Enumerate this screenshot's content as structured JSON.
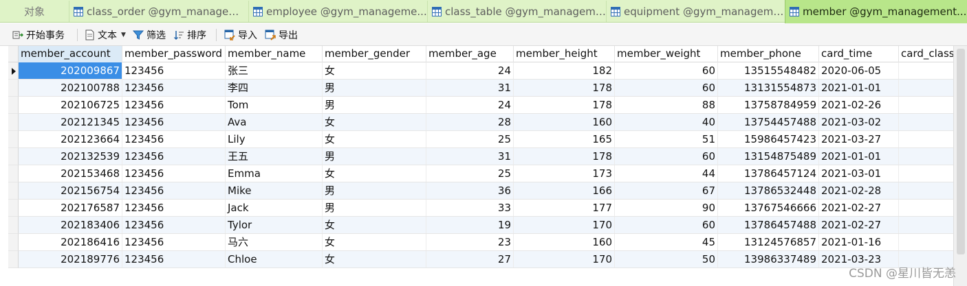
{
  "tabs": {
    "objects": "对象",
    "items": [
      {
        "label": "class_order @gym_manageme...",
        "icon": "table-icon"
      },
      {
        "label": "employee @gym_manageme...",
        "icon": "table-icon"
      },
      {
        "label": "class_table @gym_manageme...",
        "icon": "table-icon"
      },
      {
        "label": "equipment @gym_manageme...",
        "icon": "table-icon"
      },
      {
        "label": "member @gym_management...",
        "icon": "table-icon",
        "active": true
      }
    ]
  },
  "toolbar": {
    "begin_transaction": "开始事务",
    "text": "文本",
    "filter": "筛选",
    "sort": "排序",
    "import": "导入",
    "export": "导出"
  },
  "table": {
    "columns": [
      "member_account",
      "member_password",
      "member_name",
      "member_gender",
      "member_age",
      "member_height",
      "member_weight",
      "member_phone",
      "card_time",
      "card_class"
    ],
    "rows": [
      [
        "202009867",
        "123456",
        "张三",
        "女",
        "24",
        "182",
        "60",
        "13515548482",
        "2020-06-05",
        ""
      ],
      [
        "202100788",
        "123456",
        "李四",
        "男",
        "31",
        "178",
        "60",
        "13131554873",
        "2021-01-01",
        ""
      ],
      [
        "202106725",
        "123456",
        "Tom",
        "男",
        "24",
        "178",
        "88",
        "13758784959",
        "2021-02-26",
        ""
      ],
      [
        "202121345",
        "123456",
        "Ava",
        "女",
        "28",
        "160",
        "40",
        "13754457488",
        "2021-03-02",
        ""
      ],
      [
        "202123664",
        "123456",
        "Lily",
        "女",
        "25",
        "165",
        "51",
        "15986457423",
        "2021-03-27",
        ""
      ],
      [
        "202132539",
        "123456",
        "王五",
        "男",
        "31",
        "178",
        "60",
        "13154875489",
        "2021-01-01",
        ""
      ],
      [
        "202153468",
        "123456",
        "Emma",
        "女",
        "25",
        "173",
        "44",
        "13786457124",
        "2021-03-01",
        ""
      ],
      [
        "202156754",
        "123456",
        "Mike",
        "男",
        "36",
        "166",
        "67",
        "13786532448",
        "2021-02-28",
        ""
      ],
      [
        "202176587",
        "123456",
        "Jack",
        "男",
        "33",
        "177",
        "90",
        "13767546666",
        "2021-02-27",
        ""
      ],
      [
        "202183406",
        "123456",
        "Tylor",
        "女",
        "19",
        "170",
        "60",
        "13786457488",
        "2021-02-27",
        ""
      ],
      [
        "202186416",
        "123456",
        "马六",
        "女",
        "23",
        "160",
        "45",
        "13124576857",
        "2021-01-16",
        ""
      ],
      [
        "202189776",
        "123456",
        "Chloe",
        "女",
        "27",
        "170",
        "50",
        "13986337489",
        "2021-03-23",
        ""
      ]
    ]
  },
  "watermark": "CSDN @星川皆无恙",
  "colors": {
    "tab_bg": "#dff3c7",
    "active_tab": "#b8e68a",
    "selected_cell": "#3a8ee6",
    "alt_row": "#f1f6fc"
  }
}
